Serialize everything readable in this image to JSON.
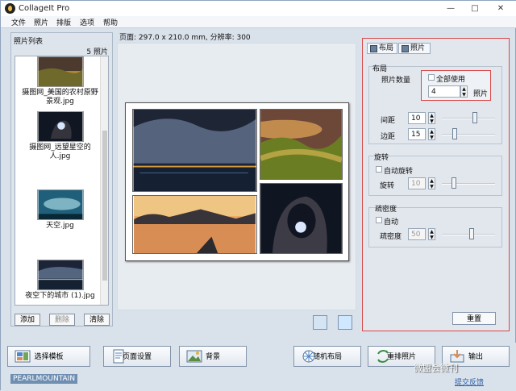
{
  "window": {
    "title": "CollageIt Pro",
    "minimize": "—",
    "maximize": "□",
    "close": "✕"
  },
  "menu": [
    "文件",
    "照片",
    "排版",
    "选项",
    "帮助"
  ],
  "photo_list": {
    "title": "照片列表",
    "count": "5 照片",
    "items": [
      "摄图网_美国的农村原野景观.jpg",
      "摄图网_远望星空的人.jpg",
      "天空.jpg",
      "夜空下的城市 (1).jpg"
    ],
    "add": "添加",
    "delete": "删除",
    "clear": "清除"
  },
  "preview": {
    "page_info": "页面: 297.0 x 210.0 mm, 分辨率: 300"
  },
  "tabs": {
    "layout": "布局",
    "photo": "照片"
  },
  "layout": {
    "group": "布局",
    "photo_count": "照片数量",
    "use_all": "全部使用",
    "count_value": "4",
    "count_unit": "照片",
    "spacing": "间距",
    "spacing_value": "10",
    "margin": "边距",
    "margin_value": "15"
  },
  "rotation": {
    "group": "旋转",
    "auto": "自动旋转",
    "label": "旋转",
    "value": "10"
  },
  "sparsity": {
    "group": "疏密度",
    "auto": "自动",
    "label": "疏密度",
    "value": "50"
  },
  "buttons": {
    "reset": "重置",
    "template": "选择模板",
    "page_setup": "页面设置",
    "background": "背景",
    "random": "随机布局",
    "rearrange": "重排照片",
    "export": "输出"
  },
  "footer": {
    "brand": "PEARLMOUNTAIN",
    "link": "提交反馈",
    "watermark": "微盟会微刊"
  },
  "icons": {
    "app": "app-icon",
    "template": "template-icon",
    "page_setup": "page-setup-icon",
    "background": "background-icon",
    "random": "random-layout-icon",
    "rearrange": "rearrange-icon",
    "export": "export-icon"
  }
}
